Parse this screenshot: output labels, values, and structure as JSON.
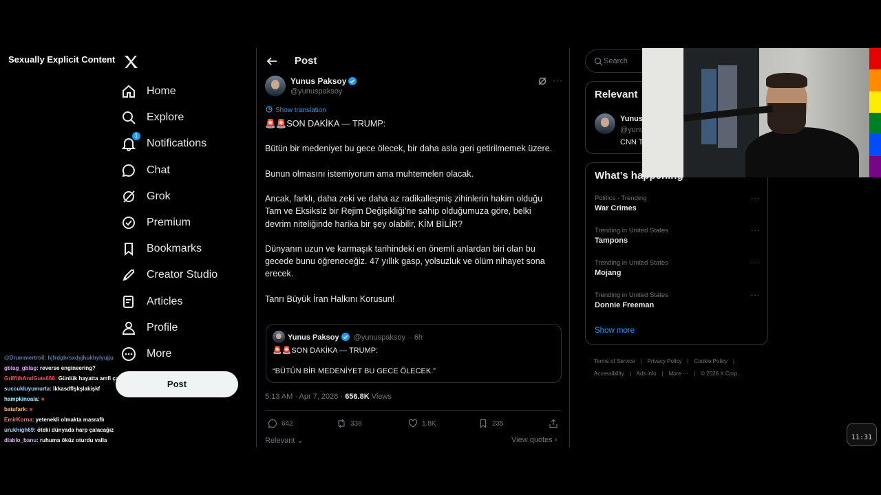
{
  "overlay": {
    "nsfw_label": "Sexually Explicit Content"
  },
  "nav": {
    "items": [
      {
        "label": "Home",
        "icon": "home-icon"
      },
      {
        "label": "Explore",
        "icon": "search-icon"
      },
      {
        "label": "Notifications",
        "icon": "bell-icon",
        "badge": "1"
      },
      {
        "label": "Chat",
        "icon": "chat-icon"
      },
      {
        "label": "Grok",
        "icon": "grok-icon"
      },
      {
        "label": "Premium",
        "icon": "premium-icon"
      },
      {
        "label": "Bookmarks",
        "icon": "bookmark-icon"
      },
      {
        "label": "Creator Studio",
        "icon": "rocket-icon"
      },
      {
        "label": "Articles",
        "icon": "articles-icon"
      },
      {
        "label": "Profile",
        "icon": "person-icon"
      },
      {
        "label": "More",
        "icon": "more-circle-icon"
      }
    ],
    "post_button": "Post"
  },
  "chat": [
    {
      "user": "@Drummertroll:",
      "msg": "hjfrdghrsxdyjhukhylyujju",
      "color": "#5b7aa8"
    },
    {
      "user": "gblag_gblag:",
      "msg": "reverse engineering?",
      "color": "#e6a5ff"
    },
    {
      "user": "GriffithAndGuts666:",
      "msg": "Günlük hayatta amfi çalıştırmak",
      "color": "#ff4b4b"
    },
    {
      "user": "succukluyumurta:",
      "msg": "Ikkasdflşkşlakişkf",
      "color": "#9fd3ff"
    },
    {
      "user": "hampkinoala:",
      "msg": "■",
      "color": "#a9f0ff"
    },
    {
      "user": "batufark:",
      "msg": "■",
      "color": "#f7c57c"
    },
    {
      "user": "EmirKorna:",
      "msg": "yetenekli olmakta masraflı",
      "color": "#ff7b7b"
    },
    {
      "user": "urukhigh69:",
      "msg": "öteki dünyada harp çalacağız",
      "color": "#9fd3ff"
    },
    {
      "user": "diablo_banu:",
      "msg": "ruhuma öküz oturdu valla",
      "color": "#d8b4ff"
    }
  ],
  "main": {
    "header": "Post",
    "author": {
      "name": "Yunus Paksoy",
      "handle": "@yunuspaksoy"
    },
    "show_translation": "Show translation",
    "body": [
      "🚨🚨SON DAKİKA — TRUMP:",
      "Bütün bir medeniyet bu gece ölecek, bir daha asla geri getirilmemek üzere.",
      "Bunun olmasını istemiyorum ama muhtemelen olacak.",
      "Ancak, farklı, daha zeki ve daha az radikalleşmiş zihinlerin hakim olduğu Tam ve Eksiksiz bir Rejim Değişikliği'ne sahip olduğumuza göre, belki devrim niteliğinde harika bir şey olabilir, KİM BİLİR?",
      "Dünyanın uzun ve karmaşık tarihindeki en önemli anlardan biri olan bu gecede bunu öğreneceğiz. 47 yıllık gasp, yolsuzluk ve ölüm nihayet sona erecek.",
      "Tanrı Büyük İran Halkını Korusun!"
    ],
    "quote": {
      "name": "Yunus Paksoy",
      "handle": "@yunuspaksoy",
      "time": "· 6h",
      "line1": "🚨🚨SON DAKİKA — TRUMP:",
      "line2": "“BÜTÜN BİR MEDENİYET BU GECE ÖLECEK.”"
    },
    "meta": {
      "timestamp": "5:13 AM · Apr 7, 2026 ·",
      "views_count": "656.8K",
      "views_label": "Views"
    },
    "actions": {
      "replies": "642",
      "reposts": "338",
      "likes": "1.8K",
      "bookmarks": "235"
    },
    "relevant": "Relevant",
    "view_quotes": "View quotes ›"
  },
  "right": {
    "search_placeholder": "Search",
    "relevant_people": {
      "title": "Relevant",
      "name": "Yunus",
      "handle": "@yunu",
      "bio": "CNN T"
    },
    "happening": {
      "title": "What’s happening",
      "trends": [
        {
          "context": "Politics · Trending",
          "name": "War Crimes"
        },
        {
          "context": "Trending in United States",
          "name": "Tampons"
        },
        {
          "context": "Trending in United States",
          "name": "Mojang"
        },
        {
          "context": "Trending in United States",
          "name": "Donnie Freeman"
        }
      ],
      "show_more": "Show more"
    },
    "footer": {
      "links_row1": [
        "Terms of Service",
        "|",
        "Privacy Policy",
        "|",
        "Cookie Policy",
        "|"
      ],
      "links_row2": [
        "Accessibility",
        "|",
        "Ads info",
        "|",
        "More ···",
        "|",
        "© 2026 X Corp."
      ]
    }
  },
  "clock": "11:31",
  "colors": {
    "accent": "#1d9bf0",
    "background": "#000000",
    "border": "#2f3336",
    "muted": "#71767b"
  }
}
